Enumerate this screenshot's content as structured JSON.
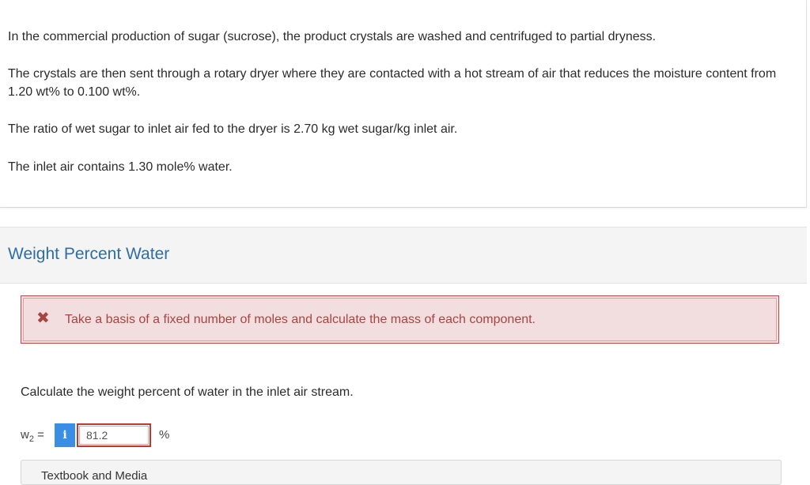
{
  "problem": {
    "paragraphs": [
      "In the commercial production of sugar (sucrose), the product crystals are washed and centrifuged to partial dryness.",
      "The crystals are then sent through a rotary dryer where they are contacted with a hot stream of air that reduces the moisture content from 1.20 wt% to 0.100 wt%.",
      "The ratio of wet sugar to inlet air fed to the dryer is 2.70 kg wet sugar/kg inlet air.",
      "The inlet air contains 1.30 mole% water."
    ]
  },
  "section": {
    "title": "Weight Percent Water"
  },
  "hint": {
    "icon": "x-mark-icon",
    "text": "Take a basis of a fixed number of moles and calculate the mass of each component.",
    "color": "#a94442"
  },
  "question": {
    "text": "Calculate the weight percent of water in the inlet air stream.",
    "variable": "w",
    "subscript": "2",
    "equals": "=",
    "info_icon": "i",
    "input_value": "81.2",
    "unit": "%"
  },
  "next_panel": {
    "text": "Textbook and Media"
  }
}
